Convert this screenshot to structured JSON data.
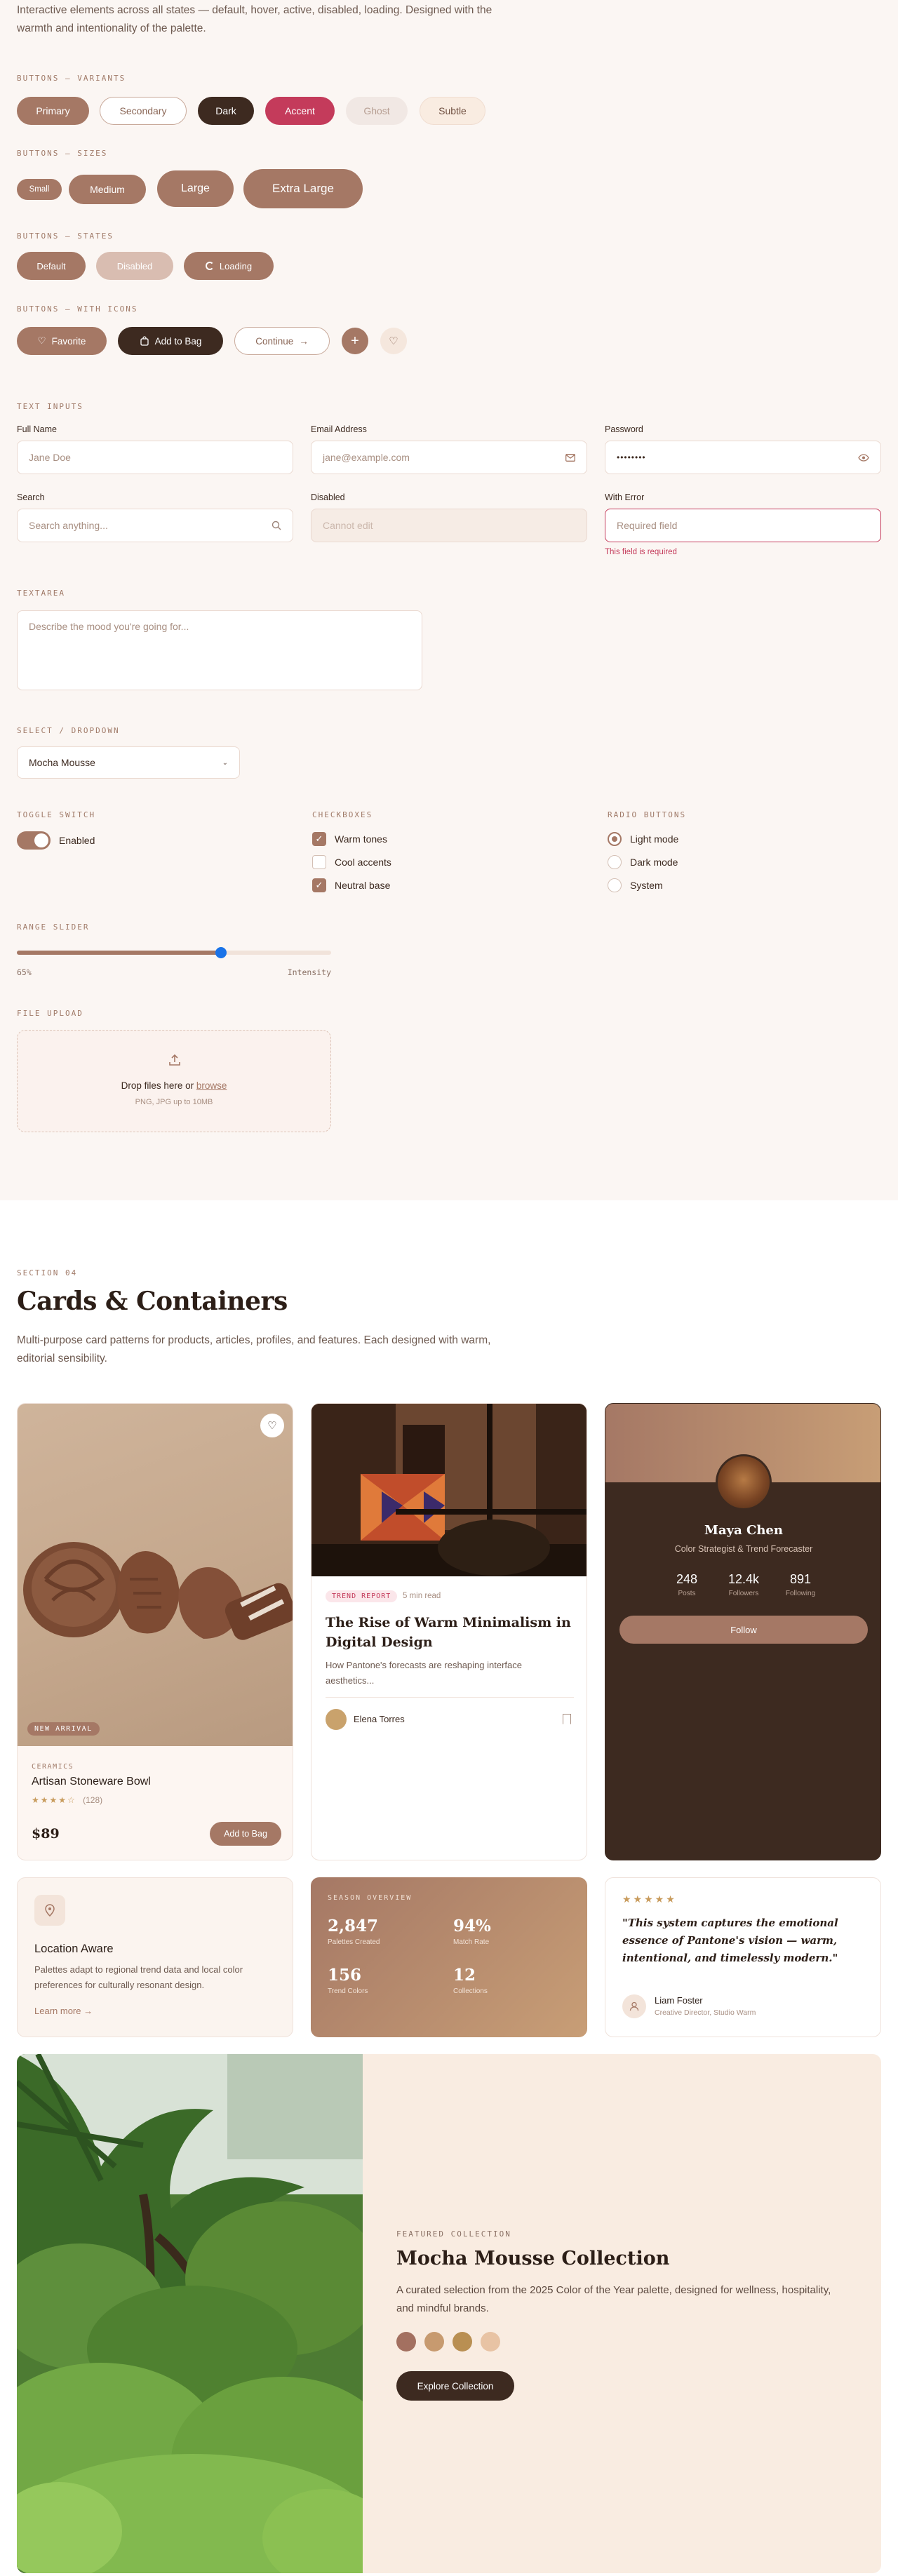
{
  "intro": {
    "text": "Interactive elements across all states — default, hover, active, disabled, loading. Designed with the warmth and intentionality of the palette."
  },
  "buttons": {
    "variants_label": "Buttons — Variants",
    "variants": [
      "Primary",
      "Secondary",
      "Dark",
      "Accent",
      "Ghost",
      "Subtle"
    ],
    "sizes_label": "Buttons — Sizes",
    "sizes": [
      "Small",
      "Medium",
      "Large",
      "Extra Large"
    ],
    "states_label": "Buttons — States",
    "states": [
      "Default",
      "Disabled",
      "Loading"
    ],
    "icons_label": "Buttons — With Icons",
    "icons": [
      "Favorite",
      "Add to Bag",
      "Continue"
    ]
  },
  "text_inputs": {
    "label": "Text Inputs",
    "full_name": {
      "label": "Full Name",
      "placeholder": "Jane Doe"
    },
    "email": {
      "label": "Email Address",
      "placeholder": "jane@example.com"
    },
    "password": {
      "label": "Password",
      "value": "••••••••"
    },
    "search": {
      "label": "Search",
      "placeholder": "Search anything..."
    },
    "disabled": {
      "label": "Disabled",
      "placeholder": "Cannot edit"
    },
    "error": {
      "label": "With Error",
      "placeholder": "Required field",
      "message": "This field is required"
    }
  },
  "textarea": {
    "label": "Textarea",
    "placeholder": "Describe the mood you're going for..."
  },
  "select": {
    "label": "Select / Dropdown",
    "value": "Mocha Mousse"
  },
  "toggle": {
    "label": "Toggle Switch",
    "text": "Enabled",
    "on": true
  },
  "checkboxes": {
    "label": "Checkboxes",
    "items": [
      {
        "text": "Warm tones",
        "checked": true
      },
      {
        "text": "Cool accents",
        "checked": false
      },
      {
        "text": "Neutral base",
        "checked": true
      }
    ]
  },
  "radios": {
    "label": "Radio Buttons",
    "items": [
      {
        "text": "Light mode",
        "selected": true
      },
      {
        "text": "Dark mode",
        "selected": false
      },
      {
        "text": "System",
        "selected": false
      }
    ]
  },
  "slider": {
    "label": "Range Slider",
    "value_text": "65%",
    "value": 0.65,
    "caption": "Intensity"
  },
  "upload": {
    "label": "File Upload",
    "text_prefix": "Drop files here or ",
    "link": "browse",
    "hint": "PNG, JPG up to 10MB"
  },
  "section04": {
    "label": "Section 04",
    "title": "Cards & Containers",
    "description": "Multi-purpose card patterns for products, articles, profiles, and features. Each designed with warm, editorial sensibility."
  },
  "product_card": {
    "badge": "New Arrival",
    "category": "Ceramics",
    "name": "Artisan Stoneware Bowl",
    "rating": 4,
    "reviews": "(128)",
    "price": "$89",
    "cta": "Add to Bag"
  },
  "article_card": {
    "tag": "Trend Report",
    "read_time": "5 min read",
    "title": "The Rise of Warm Minimalism in Digital Design",
    "excerpt": "How Pantone's forecasts are reshaping interface aesthetics...",
    "author": "Elena Torres"
  },
  "profile_card": {
    "name": "Maya Chen",
    "role": "Color Strategist & Trend Forecaster",
    "stats": [
      {
        "value": "248",
        "label": "Posts"
      },
      {
        "value": "12.4k",
        "label": "Followers"
      },
      {
        "value": "891",
        "label": "Following"
      }
    ],
    "cta": "Follow"
  },
  "location_card": {
    "title": "Location Aware",
    "text": "Palettes adapt to regional trend data and local color preferences for culturally resonant design.",
    "link": "Learn more"
  },
  "stats_card": {
    "label": "Season Overview",
    "stats": [
      {
        "value": "2,847",
        "label": "Palettes Created"
      },
      {
        "value": "94%",
        "label": "Match Rate"
      },
      {
        "value": "156",
        "label": "Trend Colors"
      },
      {
        "value": "12",
        "label": "Collections"
      }
    ]
  },
  "testimonial_card": {
    "rating": 5,
    "quote": "\"This system captures the emotional essence of Pantone's vision — warm, intentional, and timelessly modern.\"",
    "author": "Liam Foster",
    "role": "Creative Director, Studio Warm"
  },
  "feature": {
    "label": "Featured Collection",
    "title": "Mocha Mousse Collection",
    "text": "A curated selection from the 2025 Color of the Year palette, designed for wellness, hospitality, and mindful brands.",
    "swatches": [
      "#a37060",
      "#c79a6f",
      "#b98f52",
      "#e8c3a4"
    ],
    "cta": "Explore Collection"
  },
  "colors": {
    "primary": "#a57865",
    "dark": "#3d2a20",
    "accent": "#c43b5b",
    "slider_thumb": "#1a73e8"
  }
}
